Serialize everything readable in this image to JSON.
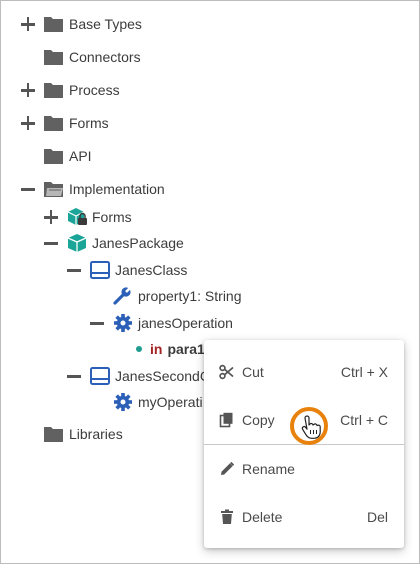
{
  "tree": {
    "base_types": "Base Types",
    "connectors": "Connectors",
    "process": "Process",
    "forms": "Forms",
    "api": "API",
    "implementation": "Implementation",
    "impl_forms": "Forms",
    "janes_package": "JanesPackage",
    "janes_class": "JanesClass",
    "property1": "property1: String",
    "janes_operation": "janesOperation",
    "param_keyword": "in",
    "param_name": "para1:",
    "janes_second_class": "JanesSecondC",
    "my_operation": "myOperati",
    "libraries": "Libraries"
  },
  "context_menu": {
    "cut": {
      "label": "Cut",
      "shortcut": "Ctrl + X"
    },
    "copy": {
      "label": "Copy",
      "shortcut": "Ctrl + C"
    },
    "rename": {
      "label": "Rename",
      "shortcut": ""
    },
    "delete": {
      "label": "Delete",
      "shortcut": "Del"
    }
  },
  "colors": {
    "folder": "#616161",
    "package": "#1aa598",
    "class": "#2c60b8",
    "operation": "#2c60b8",
    "param_keyword": "#a52323",
    "cursor_ring": "#e8820c"
  },
  "icons": {
    "folder": "folder-icon",
    "folder_open": "folder-open-icon",
    "package": "package-icon",
    "class": "class-icon",
    "property": "wrench-icon",
    "operation": "gear-icon",
    "cut": "scissors-icon",
    "copy": "copy-icon",
    "rename": "pencil-icon",
    "delete": "trash-icon"
  }
}
